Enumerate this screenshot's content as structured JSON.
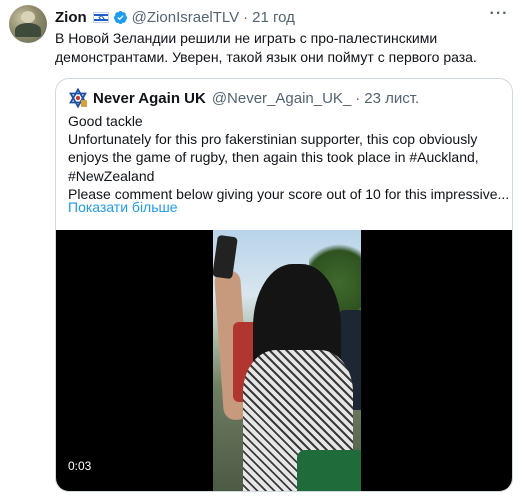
{
  "tweet": {
    "author_name": "Zion",
    "handle": "@ZionIsraelTLV",
    "separator": "·",
    "time": "21 год",
    "text": "В Новой Зеландии решили не играть с про-палестинскими демонстрантами. Уверен, такой язык они поймут с первого раза.",
    "more_icon": "more-horizontal-icon"
  },
  "quote": {
    "author_name": "Never Again UK",
    "handle": "@Never_Again_UK_",
    "separator": "·",
    "date": "23 лист.",
    "lines": [
      "Good tackle",
      "Unfortunately for this pro fakerstinian supporter, this cop obviously",
      "enjoys the game of rugby, then again this took place in #Auckland,",
      "#NewZealand",
      "Please comment below giving your score out of 10 for this impressive..."
    ],
    "show_more": "Показати більше",
    "video": {
      "timecode": "0:03"
    }
  },
  "colors": {
    "link": "#1d9bf0",
    "secondary_text": "#536471",
    "border": "#cfd9de",
    "verified": "#1d9bf0"
  }
}
